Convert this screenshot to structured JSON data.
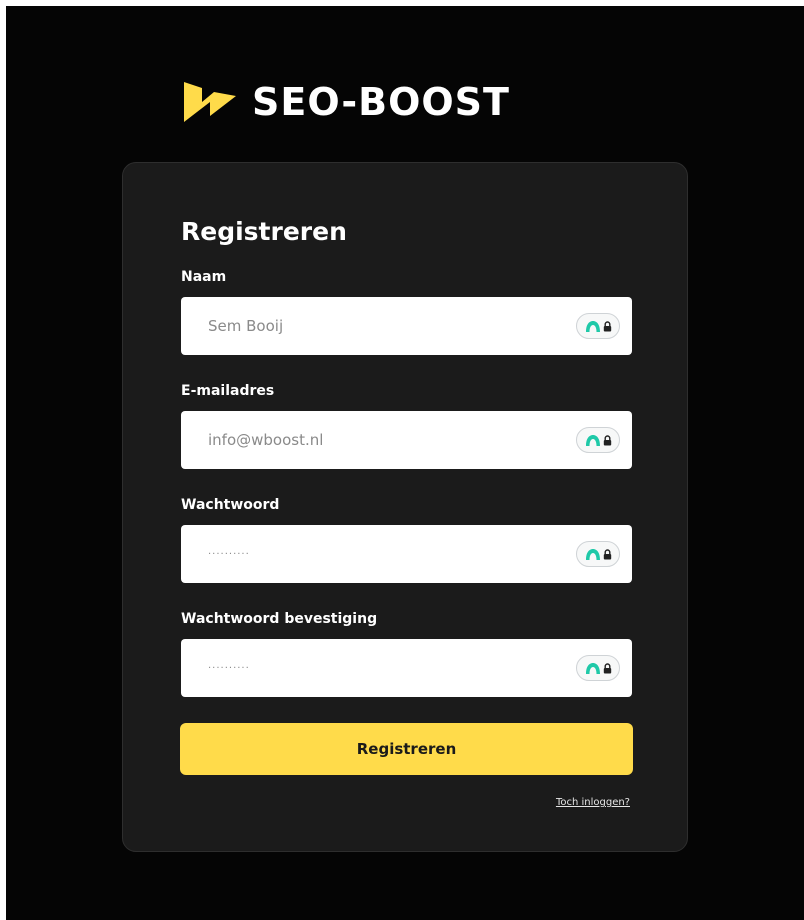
{
  "brand": {
    "name": "SEO-BOOST",
    "accent_color": "#ffdb4a",
    "logo_icon": "lightning-bolt-icon"
  },
  "form": {
    "title": "Registreren",
    "fields": [
      {
        "label": "Naam",
        "placeholder": "Sem Booij",
        "type": "text"
      },
      {
        "label": "E-mailadres",
        "placeholder": "info@wboost.nl",
        "type": "email"
      },
      {
        "label": "Wachtwoord",
        "placeholder": "··········",
        "type": "password"
      },
      {
        "label": "Wachtwoord bevestiging",
        "placeholder": "··········",
        "type": "password"
      }
    ],
    "password_manager_icon": "password-manager-lock-icon",
    "submit_label": "Registreren",
    "login_link": "Toch inloggen?"
  },
  "colors": {
    "background": "#050505",
    "card": "#1b1b1b",
    "badge_teal": "#1fc9a8"
  }
}
